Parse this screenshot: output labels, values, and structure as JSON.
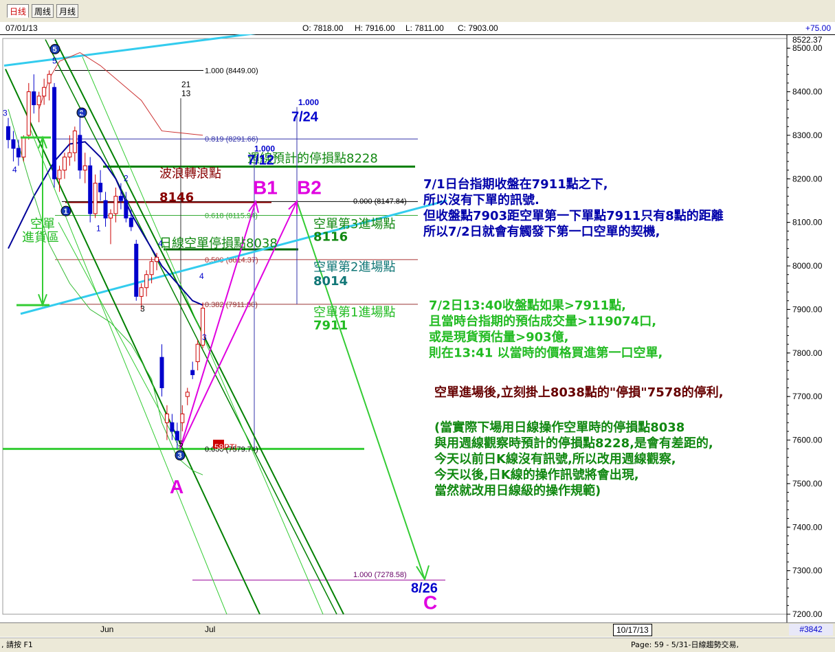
{
  "tabs": [
    {
      "label": "日线",
      "active": true
    },
    {
      "label": "周线",
      "active": false
    },
    {
      "label": "月线",
      "active": false
    }
  ],
  "header": {
    "date": "07/01/13",
    "open": "O: 7818.00",
    "high": "H: 7916.00",
    "low": "L: 7811.00",
    "close": "C: 7903.00",
    "change": "+75.00"
  },
  "footer": {
    "x_month_1": "Jun",
    "x_month_2": "Jul",
    "date_box": "10/17/13",
    "id_box": "#3842",
    "status_left": ", 請按 F1",
    "status_right": "Page: 59 - 5/31-日線趨勢交易,"
  },
  "colors": {
    "up": "#cc0000",
    "down": "#0000cc",
    "ma": "#000099",
    "channel": "#008000",
    "light_channel": "#33cc33",
    "trend": "#33ccee",
    "magenta": "#e000e0",
    "note_blue": "#0000aa",
    "note_green": "#22bb22",
    "note_dark": "#660000"
  },
  "chart_data": {
    "type": "candlestick",
    "y_range": [
      7200,
      8522.37
    ],
    "y_ticks": [
      8500,
      8400,
      8300,
      8200,
      8100,
      8000,
      7900,
      7800,
      7700,
      7600,
      7500,
      7400,
      7300,
      7200
    ],
    "y_tick_labels": [
      "8500.00",
      "8400.00",
      "8300.00",
      "8200.00",
      "8100.00",
      "8000.00",
      "7900.00",
      "7800.00",
      "7700.00",
      "7600.00",
      "7500.00",
      "7400.00",
      "7300.00",
      "7200.00"
    ],
    "y_top_label": "8522.37",
    "candles": [
      {
        "o": 8320,
        "h": 8340,
        "l": 8270,
        "c": 8290
      },
      {
        "o": 8290,
        "h": 8310,
        "l": 8240,
        "c": 8270
      },
      {
        "o": 8270,
        "h": 8290,
        "l": 8230,
        "c": 8250
      },
      {
        "o": 8250,
        "h": 8300,
        "l": 8240,
        "c": 8295
      },
      {
        "o": 8300,
        "h": 8420,
        "l": 8290,
        "c": 8400
      },
      {
        "o": 8400,
        "h": 8440,
        "l": 8350,
        "c": 8370
      },
      {
        "o": 8370,
        "h": 8400,
        "l": 8330,
        "c": 8390
      },
      {
        "o": 8390,
        "h": 8430,
        "l": 8370,
        "c": 8410
      },
      {
        "o": 8420,
        "h": 8449,
        "l": 8380,
        "c": 8440
      },
      {
        "o": 8410,
        "h": 8420,
        "l": 8180,
        "c": 8200
      },
      {
        "o": 8200,
        "h": 8230,
        "l": 8170,
        "c": 8220
      },
      {
        "o": 8220,
        "h": 8260,
        "l": 8200,
        "c": 8250
      },
      {
        "o": 8250,
        "h": 8300,
        "l": 8230,
        "c": 8260
      },
      {
        "o": 8260,
        "h": 8320,
        "l": 8240,
        "c": 8310
      },
      {
        "o": 8300,
        "h": 8350,
        "l": 8200,
        "c": 8220
      },
      {
        "o": 8220,
        "h": 8260,
        "l": 8190,
        "c": 8230
      },
      {
        "o": 8230,
        "h": 8250,
        "l": 8100,
        "c": 8120
      },
      {
        "o": 8120,
        "h": 8210,
        "l": 8110,
        "c": 8190
      },
      {
        "o": 8190,
        "h": 8220,
        "l": 8150,
        "c": 8170
      },
      {
        "o": 8150,
        "h": 8170,
        "l": 8090,
        "c": 8110
      },
      {
        "o": 8110,
        "h": 8130,
        "l": 8050,
        "c": 8120
      },
      {
        "o": 8120,
        "h": 8180,
        "l": 8100,
        "c": 8160
      },
      {
        "o": 8160,
        "h": 8190,
        "l": 8130,
        "c": 8150
      },
      {
        "o": 8150,
        "h": 8170,
        "l": 8100,
        "c": 8110
      },
      {
        "o": 8110,
        "h": 8130,
        "l": 8080,
        "c": 8090
      },
      {
        "o": 8050,
        "h": 8060,
        "l": 7920,
        "c": 7930
      },
      {
        "o": 7930,
        "h": 7960,
        "l": 7900,
        "c": 7950
      },
      {
        "o": 7950,
        "h": 7990,
        "l": 7930,
        "c": 7980
      },
      {
        "o": 7980,
        "h": 8020,
        "l": 7960,
        "c": 8010
      },
      {
        "o": 8010,
        "h": 8030,
        "l": 7990,
        "c": 8020
      },
      {
        "o": 7790,
        "h": 7820,
        "l": 7700,
        "c": 7720
      },
      {
        "o": 7640,
        "h": 7680,
        "l": 7600,
        "c": 7660
      },
      {
        "o": 7640,
        "h": 7660,
        "l": 7600,
        "c": 7620
      },
      {
        "o": 7620,
        "h": 7640,
        "l": 7579.74,
        "c": 7600
      },
      {
        "o": 7640,
        "h": 7680,
        "l": 7620,
        "c": 7660
      },
      {
        "o": 7700,
        "h": 7720,
        "l": 7680,
        "c": 7710
      },
      {
        "o": 7760,
        "h": 7780,
        "l": 7740,
        "c": 7750
      },
      {
        "o": 7780,
        "h": 7830,
        "l": 7760,
        "c": 7820
      },
      {
        "o": 7818,
        "h": 7916,
        "l": 7811,
        "c": 7903
      }
    ],
    "ma_curve": [
      [
        0,
        8040
      ],
      [
        5,
        8160
      ],
      [
        9,
        8240
      ],
      [
        12,
        8280
      ],
      [
        15,
        8285
      ],
      [
        18,
        8250
      ],
      [
        21,
        8200
      ],
      [
        24,
        8120
      ],
      [
        27,
        8060
      ],
      [
        30,
        8000
      ],
      [
        33,
        7960
      ],
      [
        36,
        7920
      ],
      [
        38,
        7910
      ]
    ],
    "fib_levels_1": [
      {
        "value": 8449.0,
        "label": "1.000 (8449.00)"
      },
      {
        "value": 8291.66,
        "label": "0.819 (8291.66)"
      },
      {
        "value": 8115.94,
        "label": "0.618 (8115.94)"
      },
      {
        "value": 8014.37,
        "label": "0.500 (8014.37)"
      },
      {
        "value": 7911.8,
        "label": "0.382 (7911.80)"
      },
      {
        "value": 7579.74,
        "label": "0.000 (7579.74)"
      }
    ],
    "fib_level_top": {
      "value": 8147.84,
      "label": "0.000 (8147.84)"
    },
    "fib_level_bottom": {
      "value": 7278.58,
      "label": "1.000 (7278.58)"
    },
    "time_markers": [
      {
        "ratio": "1.000",
        "date": "7/12"
      },
      {
        "ratio": "1.000",
        "date": "7/24"
      },
      {
        "date": "8/26"
      }
    ],
    "wave_labels": [
      "5",
      "4",
      "3",
      "2",
      "1",
      "2",
      "1",
      "3",
      "4",
      "5",
      "4",
      "3",
      "21",
      "13",
      "58",
      "PTI"
    ],
    "pattern_points": [
      "A",
      "B1",
      "B2",
      "C"
    ],
    "annotations": {
      "stop_week": "週線預計的停損點8228",
      "wave_turn_1": "波浪轉浪點",
      "wave_turn_2": "8146",
      "stop_day": "日線空單停損點8038",
      "entry3_1": "空單第3進場點",
      "entry3_2": "8116",
      "entry2_1": "空單第2進場點",
      "entry2_2": "8014",
      "entry1_1": "空單第1進場點",
      "entry1_2": "7911",
      "zone_1": "空單",
      "zone_2": "進貨區"
    },
    "notes": {
      "blue": [
        "7/1日台指期收盤在7911點之下,",
        "所以沒有下單的訊號.",
        "但收盤點7903距空單第一下單點7911只有8點的距離",
        "所以7/2日就會有觸發下第一口空單的契機,"
      ],
      "green": [
        "7/2日13:40收盤點如果>7911點,",
        "且當時台指期的預估成交量>119074口,",
        "或是現貨預估量>903億,",
        "則在13:41 以當時的價格買進第一口空單,"
      ],
      "dark": "空單進場後,立刻掛上8038點的\"停損\"7578的停利,",
      "green2": [
        "(當實際下場用日線操作空單時的停損點8038",
        "與用週線觀察時預計的停損點8228,是會有差距的,",
        "今天以前日K線沒有訊號,所以改用週線觀察,",
        "今天以後,日K線的操作訊號將會出現,",
        "當然就改用日線級的操作規範)"
      ]
    }
  }
}
